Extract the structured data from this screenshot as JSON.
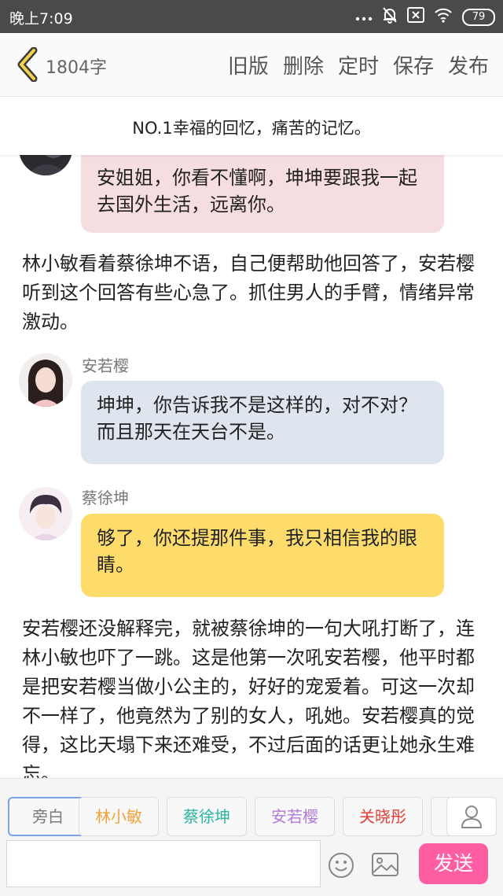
{
  "status_bar": {
    "time": "晚上7:09",
    "battery": "79",
    "icons": [
      "more-dots-icon",
      "mute-bell-icon",
      "sim-x-icon",
      "wifi-icon",
      "battery-icon"
    ]
  },
  "header": {
    "word_count": "1804字",
    "actions": [
      "旧版",
      "删除",
      "定时",
      "保存",
      "发布"
    ]
  },
  "chapter_title": "NO.1幸福的回忆，痛苦的记忆。",
  "messages": {
    "m1": {
      "text": "安姐姐，你看不懂啊，坤坤要跟我一起去国外生活，远离你。",
      "color": "#f5dde0"
    },
    "n1": {
      "text": "林小敏看着蔡徐坤不语，自己便帮助他回答了，安若樱听到这个回答有些心急了。抓住男人的手臂，情绪异常激动。"
    },
    "m2": {
      "speaker": "安若樱",
      "text": "坤坤，你告诉我不是这样的，对不对？而且那天在天台不是。",
      "color": "#dfe5ef"
    },
    "m3": {
      "speaker": "蔡徐坤",
      "text": "够了，你还提那件事，我只相信我的眼睛。",
      "color": "#fddc6c"
    },
    "n2": {
      "text": "安若樱还没解释完，就被蔡徐坤的一句大吼打断了，连林小敏也吓了一跳。这是他第一次吼安若樱，他平时都是把安若樱当做小公主的，好好的宠爱着。可这一次却不一样了，他竟然为了别的女人，吼她。安若樱真的觉得，这比天塌下来还难受，不过后面的话更让她永生难忘。"
    }
  },
  "roles": [
    {
      "label": "旁白",
      "color": "#7a7a7a",
      "active": true
    },
    {
      "label": "林小敏",
      "color": "#f0a33a",
      "active": false
    },
    {
      "label": "蔡徐坤",
      "color": "#2bb5a0",
      "active": false
    },
    {
      "label": "安若樱",
      "color": "#b07ad8",
      "active": false
    },
    {
      "label": "关晓彤",
      "color": "#e0403a",
      "active": false
    }
  ],
  "composer": {
    "input_value": "",
    "send_label": "发送",
    "send_color": "#ff5fa2"
  }
}
